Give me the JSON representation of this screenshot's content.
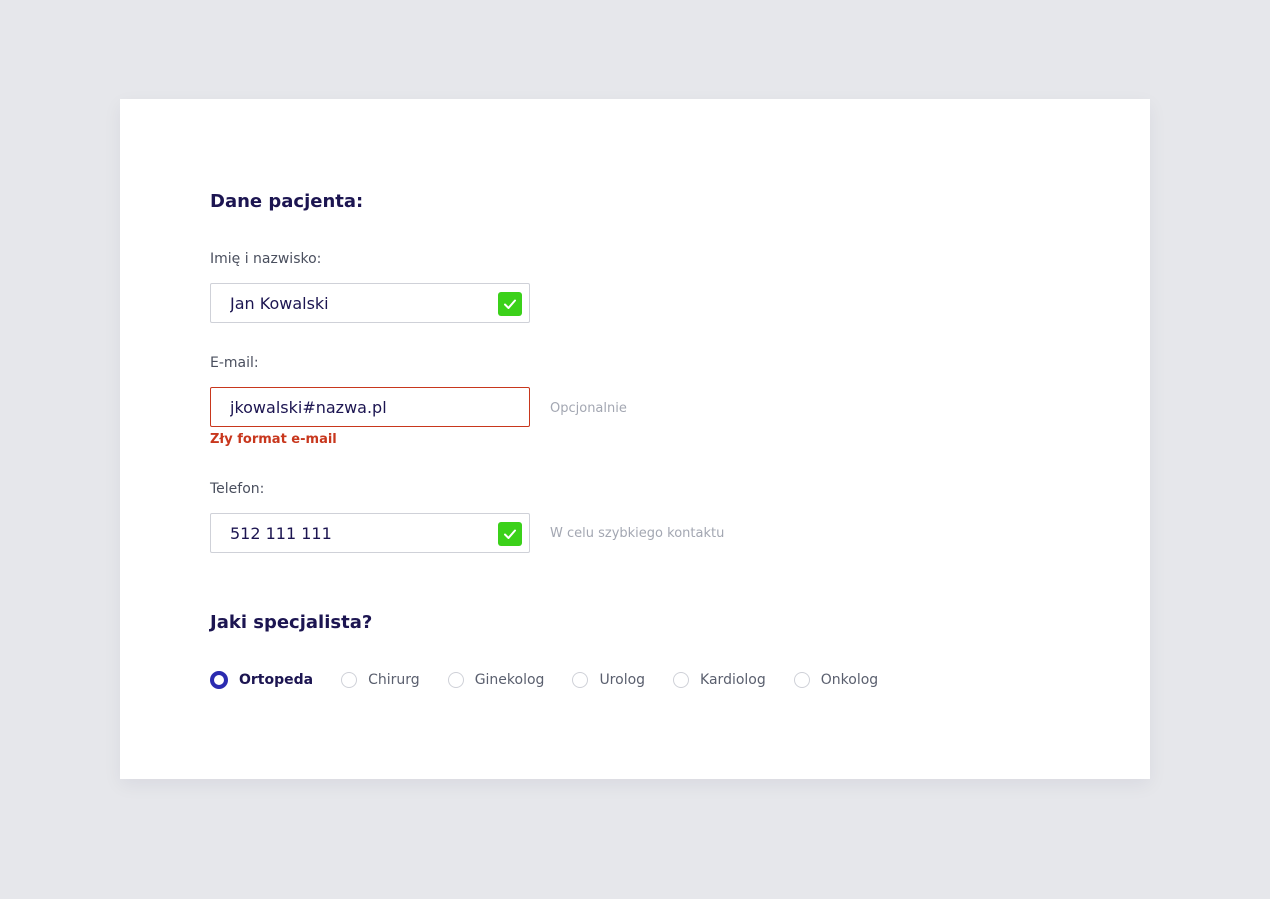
{
  "patient": {
    "title": "Dane pacjenta:",
    "name": {
      "label": "Imię i nazwisko:",
      "value": "Jan Kowalski",
      "status": "valid"
    },
    "email": {
      "label": "E-mail:",
      "value": "jkowalski#nazwa.pl",
      "hint": "Opcjonalnie",
      "error": "Zły format e-mail",
      "status": "error"
    },
    "phone": {
      "label": "Telefon:",
      "value": "512 111 111",
      "hint": "W celu szybkiego kontaktu",
      "status": "valid"
    }
  },
  "specialist": {
    "title": "Jaki specjalista?",
    "options": [
      {
        "label": "Ortopeda",
        "selected": true
      },
      {
        "label": "Chirurg",
        "selected": false
      },
      {
        "label": "Ginekolog",
        "selected": false
      },
      {
        "label": "Urolog",
        "selected": false
      },
      {
        "label": "Kardiolog",
        "selected": false
      },
      {
        "label": "Onkolog",
        "selected": false
      }
    ]
  },
  "icons": {
    "valid": "check-icon"
  },
  "colors": {
    "background": "#e6e7eb",
    "card": "#ffffff",
    "heading": "#1c1551",
    "valid": "#3bd11a",
    "error": "#c8371d",
    "accent": "#2b2bb0",
    "hint": "#a3a7b2"
  }
}
